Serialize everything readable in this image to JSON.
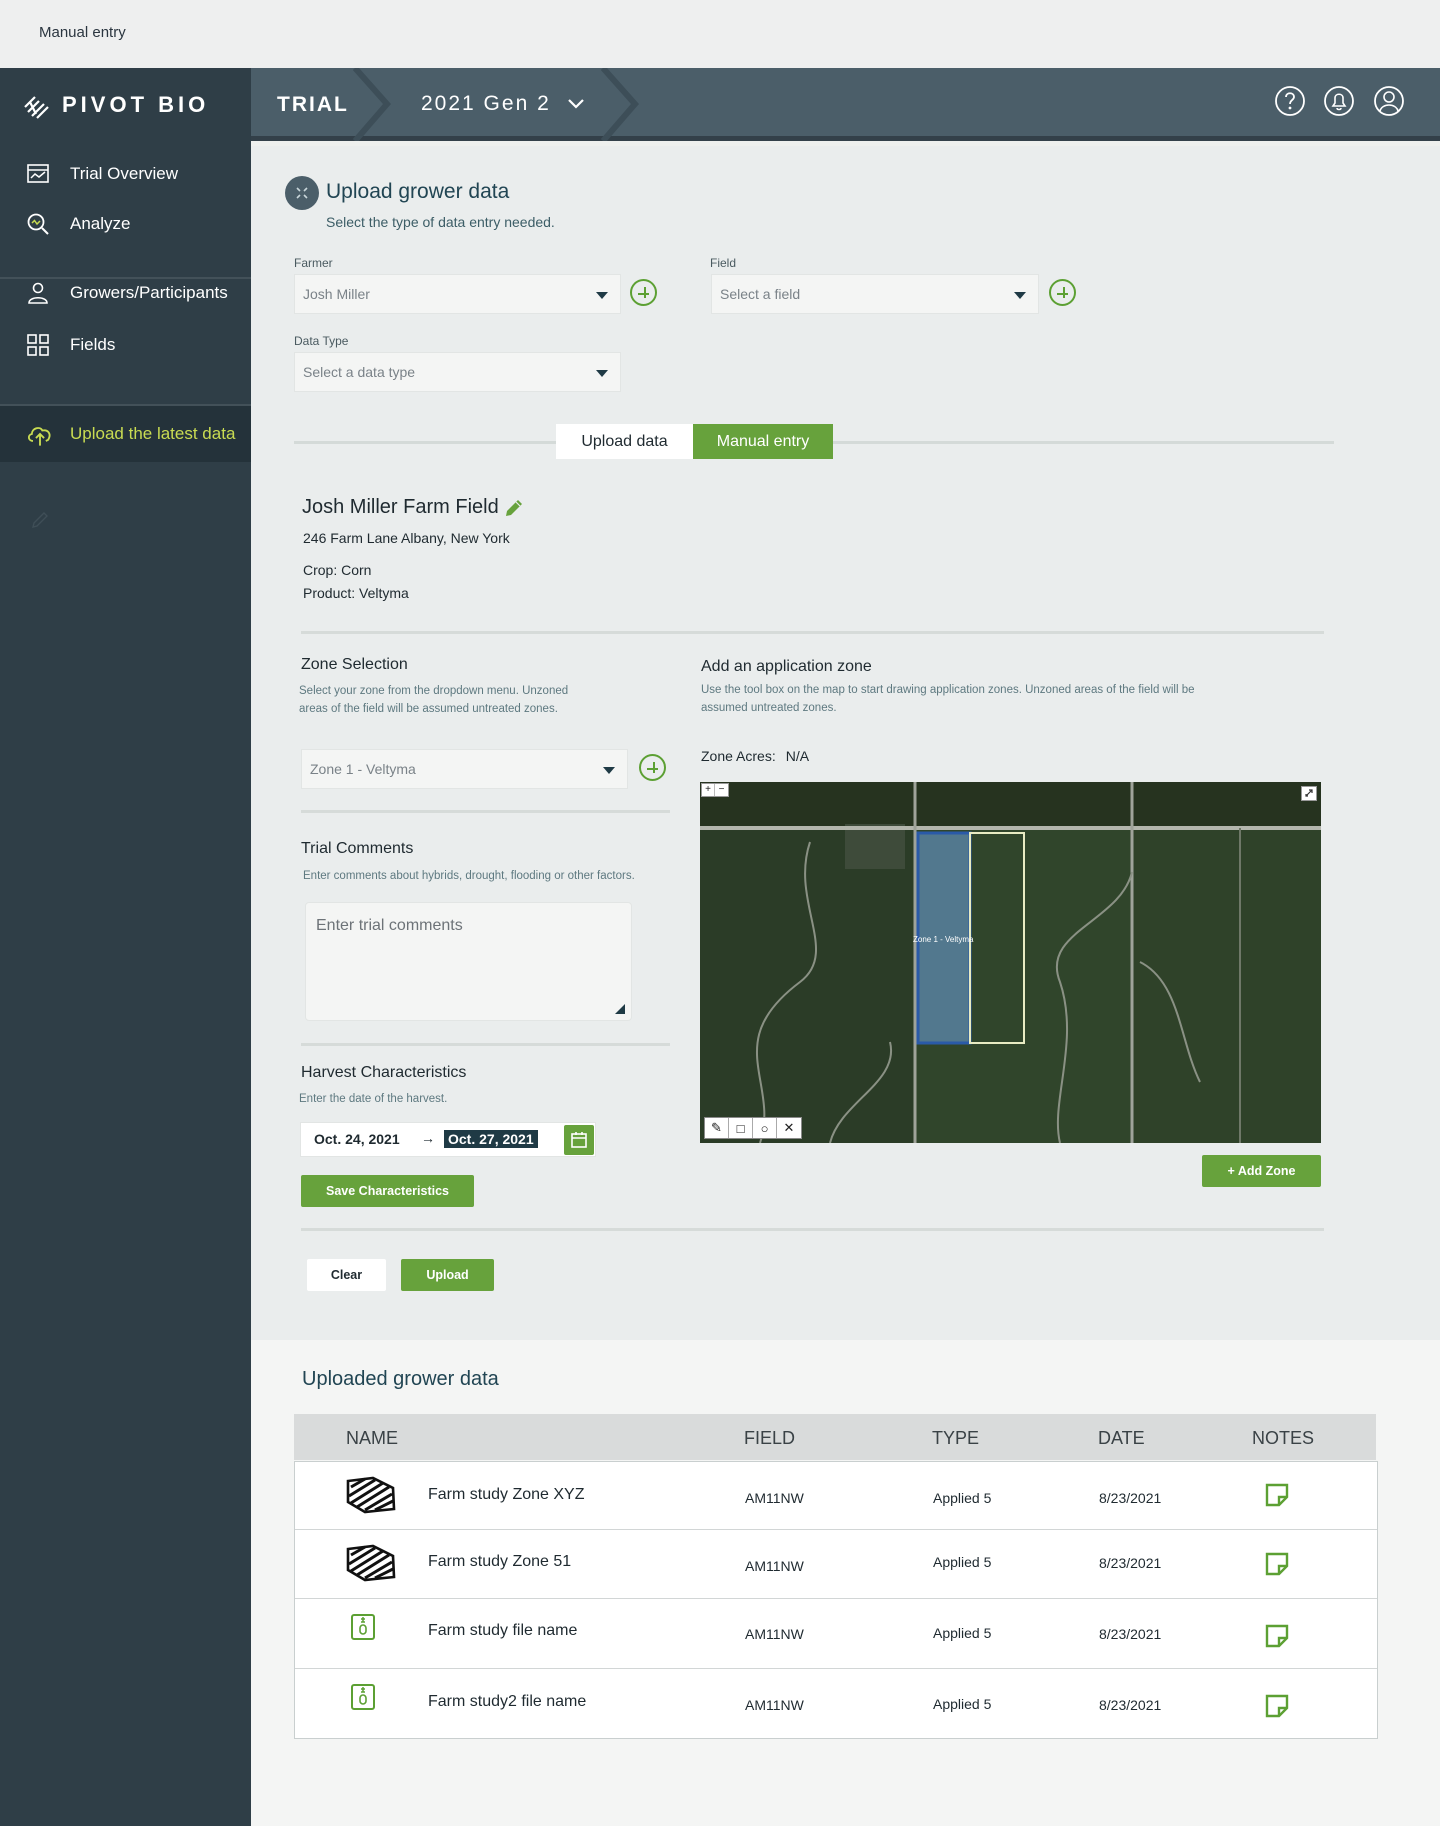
{
  "window": {
    "breadcrumb": "Manual entry"
  },
  "brand": {
    "name": "PIVOT BIO"
  },
  "sidebar": {
    "items": [
      {
        "label": "Trial Overview",
        "icon": "chart-icon"
      },
      {
        "label": "Analyze",
        "icon": "analyze-icon"
      },
      {
        "label": "Growers/Participants",
        "icon": "person-icon"
      },
      {
        "label": "Fields",
        "icon": "grid-icon"
      },
      {
        "label": "Upload the latest data",
        "icon": "cloud-upload-icon"
      }
    ],
    "extra_icon": "pencil-icon"
  },
  "header": {
    "section": "TRIAL",
    "trial_name": "2021 Gen 2",
    "icons": [
      "help-icon",
      "bell-icon",
      "user-icon"
    ]
  },
  "upload": {
    "title": "Upload grower data",
    "subtitle": "Select the type of data entry needed.",
    "farmer_label": "Farmer",
    "farmer_value": "Josh Miller",
    "field_label": "Field",
    "field_placeholder": "Select a field",
    "datatype_label": "Data Type",
    "datatype_placeholder": "Select a data type",
    "tabs": [
      "Upload data",
      "Manual entry"
    ],
    "active_tab": "Manual entry"
  },
  "farm": {
    "title": "Josh Miller Farm Field",
    "address": "246 Farm Lane Albany, New York",
    "crop": "Crop: Corn",
    "product": "Product: Veltyma"
  },
  "zone_selection": {
    "title": "Zone Selection",
    "desc_line1": "Select your zone from the dropdown menu. Unzoned",
    "desc_line2": "areas of the field will be assumed untreated zones.",
    "selected": "Zone 1 - Veltyma"
  },
  "trial_comments": {
    "title": "Trial Comments",
    "desc": "Enter comments about hybrids, drought, flooding or other factors.",
    "placeholder": "Enter trial comments"
  },
  "harvest": {
    "title": "Harvest Characteristics",
    "desc": "Enter the date of the harvest.",
    "start_date": "Oct. 24, 2021",
    "arrow": "→",
    "end_date": "Oct. 27, 2021",
    "save_label": "Save Characteristics"
  },
  "app_zone": {
    "title": "Add an application zone",
    "desc_line1": "Use the tool box on the map to start drawing application zones. Unzoned areas of the field will be",
    "desc_line2": "assumed untreated zones.",
    "acres_label": "Zone Acres:",
    "acres_value": "N/A",
    "map_zone_label": "Zone 1 - Veltyma",
    "map_zoom_in": "+",
    "map_zoom_out": "−",
    "map_tools": [
      "✎",
      "□",
      "○",
      "✕"
    ],
    "add_zone_label": "+ Add Zone"
  },
  "actions": {
    "clear_label": "Clear",
    "upload_label": "Upload"
  },
  "uploaded": {
    "title": "Uploaded grower data",
    "columns": [
      "NAME",
      "FIELD",
      "TYPE",
      "DATE",
      "NOTES"
    ],
    "rows": [
      {
        "icon": "zone-shape-icon",
        "name": "Farm study Zone XYZ",
        "field": "AM11NW",
        "type": "Applied 5",
        "date": "8/23/2021"
      },
      {
        "icon": "zone-shape-icon",
        "name": "Farm study Zone 51",
        "field": "AM11NW",
        "type": "Applied 5",
        "date": "8/23/2021"
      },
      {
        "icon": "zip-file-icon",
        "name": "Farm study file name",
        "field": "AM11NW",
        "type": "Applied 5",
        "date": "8/23/2021"
      },
      {
        "icon": "zip-file-icon",
        "name": "Farm study2 file name",
        "field": "AM11NW",
        "type": "Applied 5",
        "date": "8/23/2021"
      }
    ]
  },
  "colors": {
    "sidebar": "#2f3e47",
    "header": "#4b5e69",
    "accent_green": "#67a23c",
    "active_nav_text": "#c9dc52"
  }
}
